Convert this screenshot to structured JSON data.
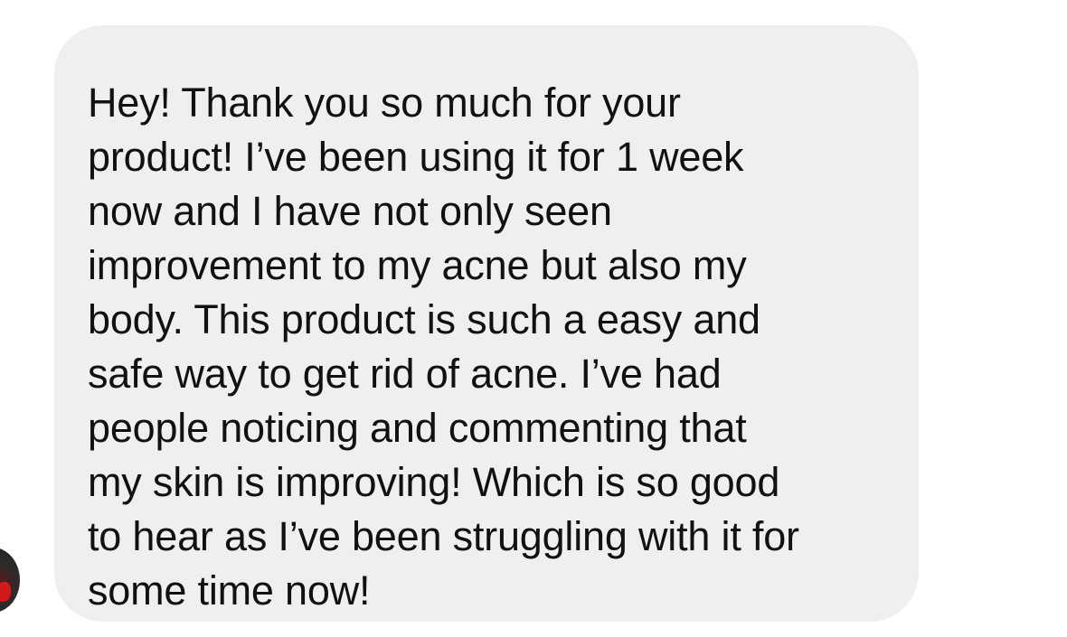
{
  "conversation": {
    "incoming_message": {
      "lines": [
        "Hey! Thank you so much for your",
        "product! I’ve been using it for 1 week",
        "now and I have not only seen",
        "improvement to my acne but also my",
        "body. This product is such a easy and",
        "safe way to get rid of acne. I’ve had",
        "people noticing and commenting that",
        "my skin is improving! Which is so good",
        "to hear as I’ve been struggling with it for",
        "some time now!"
      ]
    },
    "sender_avatar": {
      "icon": "avatar-photo",
      "accent_color": "#d11a1a"
    }
  },
  "colors": {
    "background": "#ffffff",
    "bubble": "#efefef",
    "text": "#111111"
  }
}
